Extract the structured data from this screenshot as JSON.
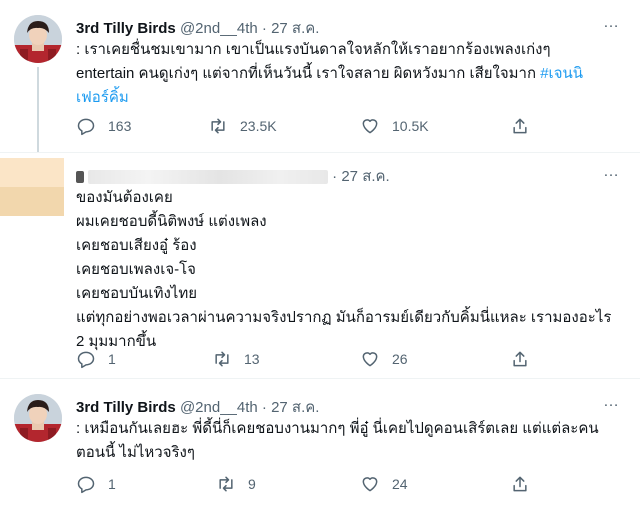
{
  "tweets": [
    {
      "name": "3rd Tilly Birds",
      "handle": "@2nd__4th",
      "separator": "·",
      "time": "27 ส.ค.",
      "lines": [
        ": เราเคยชื่นชมเขามาก เขาเป็นแรงบันดาลใจหลักให้เราอยากร้องเพลงเก่งๆ",
        "entertain คนดูเก่งๆ แต่จากที่เห็นวันนี้ เราใจสลาย ผิดหวังมาก เสียใจมาก"
      ],
      "line2_hashtag": "#เจนนิ",
      "line3_hashtag": "เฟอร์คิ้ม",
      "counts": {
        "reply": "163",
        "retweet": "23.5K",
        "like": "10.5K"
      }
    },
    {
      "name": "",
      "separator": "·",
      "time": "27 ส.ค.",
      "lines": [
        "ของมันต้องเคย",
        "ผมเคยชอบดี้นิติพงษ์ แต่งเพลง",
        "เคยชอบเสียงอู๋ ร้อง",
        "เคยชอบเพลงเจ-โจ",
        "เคยชอบบันเทิงไทย",
        "แต่ทุกอย่างพอเวลาผ่านความจริงปรากฏ มันก็อารมย์เดียวกับคิ้มนี่แหละ เรามองอะไร",
        "2 มุมมากขึ้น"
      ],
      "counts": {
        "reply": "1",
        "retweet": "13",
        "like": "26"
      }
    },
    {
      "name": "3rd Tilly Birds",
      "handle": "@2nd__4th",
      "separator": "·",
      "time": "27 ส.ค.",
      "lines": [
        ": เหมือนกันเลยฮะ พี่ดี้นี่ก็เคยชอบงานมากๆ พี่อู๋ นี่เคยไปดูคอนเสิร์ตเลย แต่แต่ละคน",
        "ตอนนี้ ไม่ไหวจริงๆ"
      ],
      "counts": {
        "reply": "1",
        "retweet": "9",
        "like": "24"
      }
    }
  ],
  "more_icon": "…",
  "icons": [
    "more-icon",
    "reply-icon",
    "retweet-icon",
    "like-icon",
    "share-icon"
  ],
  "colors": {
    "text": "#0f1419",
    "secondary": "#536471",
    "link": "#1d9bf0",
    "border": "#eff3f4",
    "thread": "#cfd9de"
  }
}
